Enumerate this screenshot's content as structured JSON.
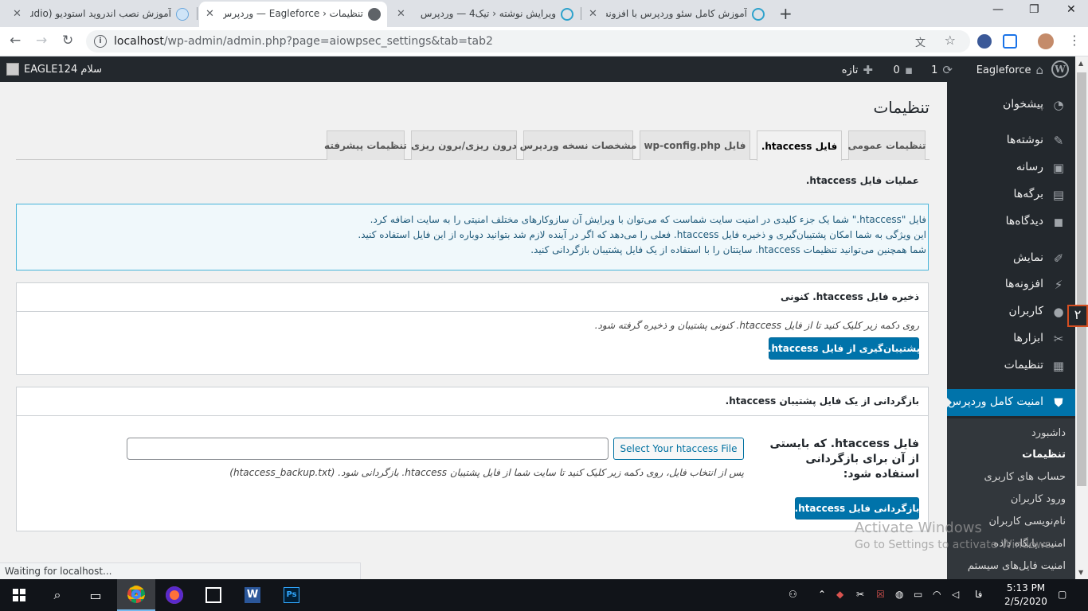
{
  "browser": {
    "tabs": [
      {
        "title": "آموزش نصب اندروید استودیو (studio",
        "active": false
      },
      {
        "title": "تنظیمات ‹ Eagleforce — وردپرس",
        "active": true
      },
      {
        "title": "ویرایش نوشته ‹ تیک4 — وردپرس",
        "active": false
      },
      {
        "title": "آموزش کامل سئو وردپرس با افزونه",
        "active": false
      }
    ],
    "new_tab": "+",
    "url_host": "localhost",
    "url_path": "/wp-admin/admin.php?page=aiowpsec_settings&tab=tab2",
    "status": "Waiting for localhost..."
  },
  "adminbar": {
    "site_name": "Eagleforce",
    "updates_count": "1",
    "comments_count": "0",
    "new_label": "تازه",
    "howdy": "سلام EAGLE124",
    "wp_logo": "W"
  },
  "sidebar": {
    "items": [
      {
        "label": "پیشخوان",
        "icon": "dashboard-icon",
        "glyph": "◔"
      },
      {
        "label": "نوشته‌ها",
        "icon": "pin-icon",
        "glyph": "✎"
      },
      {
        "label": "رسانه",
        "icon": "media-icon",
        "glyph": "▣"
      },
      {
        "label": "برگه‌ها",
        "icon": "pages-icon",
        "glyph": "▤"
      },
      {
        "label": "دیدگاه‌ها",
        "icon": "comments-icon",
        "glyph": "◼"
      },
      {
        "label": "نمایش",
        "icon": "appearance-icon",
        "glyph": "✐"
      },
      {
        "label": "افزونه‌ها",
        "icon": "plugins-icon",
        "glyph": "⚡"
      },
      {
        "label": "کاربران",
        "icon": "users-icon",
        "glyph": "●"
      },
      {
        "label": "ابزارها",
        "icon": "tools-icon",
        "glyph": "✂"
      },
      {
        "label": "تنظیمات",
        "icon": "settings-icon",
        "glyph": "▦"
      }
    ],
    "current": {
      "label": "امنیت کامل وردپرس",
      "icon": "shield-icon",
      "glyph": "⛊"
    },
    "submenu": [
      "داشبورد",
      "تنظیمات",
      "حساب های کاربری",
      "ورود کاربران",
      "نام‌نویسی کاربران",
      "امنیت پایگاه داده",
      "امنیت فایل‌های سیستم"
    ]
  },
  "main": {
    "page_title": "تنظیمات",
    "tabs": [
      "تنظیمات عمومی",
      "فایل htaccess.",
      "فایل wp-config.php",
      "مشخصات نسخه وردپرس",
      "درون ریزی/برون ریزی",
      "تنظیمات پیشرفته"
    ],
    "section_title": "عملیات فایل htaccess.",
    "notice_lines": [
      "فایل \"htaccess.\" شما یک جزء کلیدی در امنیت سایت شماست که می‌توان با ویرایش آن سازوکارهای مختلف امنیتی را به سایت اضافه کرد.",
      "این ویژگی به شما امکان پشتیبان‌گیری و ذخیره فایل htaccess. فعلی را می‌دهد که اگر در آینده لازم شد بتوانید دوباره از این فایل استفاده کنید.",
      "شما همچنین می‌توانید تنظیمات htaccess. سایتتان را با استفاده از یک فایل پشتیبان بازگردانی کنید."
    ],
    "backup_box": {
      "title": "ذخیره فایل htaccess. کنونی",
      "desc": "روی دکمه زیر کلیک کنید تا از فایل htaccess. کنونی پشتیبان و ذخیره گرفته شود.",
      "button": "پشتیبان‌گیری از فایل htaccess."
    },
    "restore_box": {
      "title": "بازگردانی از یک فایل پشتیبان htaccess.",
      "label": "فایل htaccess. که بایستی از آن برای بازگردانی استفاده شود:",
      "select_button": "Select Your htaccess File",
      "file_value": "",
      "desc": "پس از انتخاب فایل، روی دکمه زیر کلیک کنید تا سایت شما از فایل پشتیبان htaccess. بازگردانی شود. (htaccess_backup.txt)",
      "button": "بازگردانی فایل htaccess."
    }
  },
  "watermark": {
    "line1": "Activate Windows",
    "line2": "Go to Settings to activate Windows."
  },
  "taskbar": {
    "time": "5:13 PM",
    "date": "2/5/2020",
    "lang": "فا",
    "apps": [
      "chrome-icon",
      "firefox-icon",
      "app-icon",
      "word-icon",
      "photoshop-icon"
    ]
  },
  "colors": {
    "wp_blue": "#0073aa",
    "admin_dark": "#23282d",
    "notice_border": "#46b4d9"
  }
}
